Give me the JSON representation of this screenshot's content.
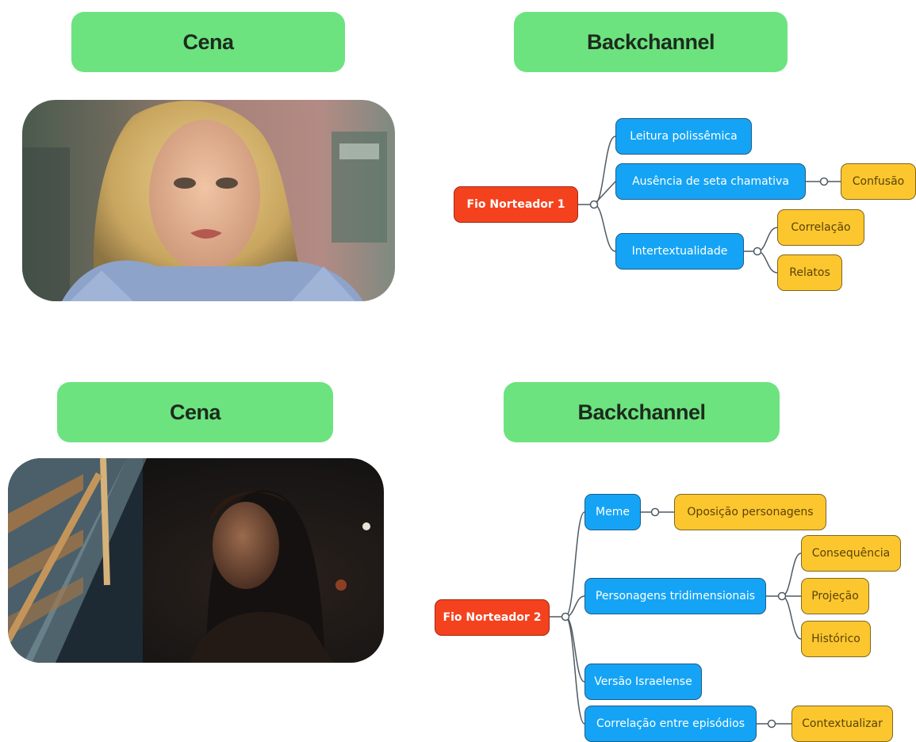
{
  "section1": {
    "scene_header": "Cena",
    "backchannel_header": "Backchannel",
    "mindmap": {
      "root": "Fio Norteador 1",
      "branches": [
        {
          "label": "Leitura polissêmica",
          "children": []
        },
        {
          "label": "Ausência de seta chamativa",
          "children": [
            "Confusão"
          ]
        },
        {
          "label": "Intertextualidade",
          "children": [
            "Correlação",
            "Relatos"
          ]
        }
      ]
    }
  },
  "section2": {
    "scene_header": "Cena",
    "backchannel_header": "Backchannel",
    "mindmap": {
      "root": "Fio Norteador 2",
      "branches": [
        {
          "label": "Meme",
          "children": [
            "Oposição personagens"
          ]
        },
        {
          "label": "Personagens tridimensionais",
          "children": [
            "Consequência",
            "Projeção",
            "Histórico"
          ]
        },
        {
          "label": "Versão Israelense",
          "children": []
        },
        {
          "label": "Correlação entre episódios",
          "children": [
            "Contextualizar"
          ]
        }
      ]
    }
  },
  "colors": {
    "header_green": "#6ce37f",
    "root_red": "#f4421e",
    "branch_blue": "#15a4f5",
    "leaf_yellow": "#fcc72e"
  }
}
